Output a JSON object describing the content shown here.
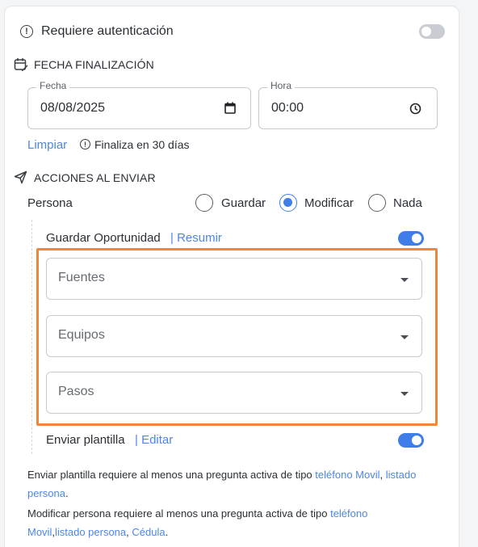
{
  "auth": {
    "label": "Requiere autenticación",
    "enabled": false
  },
  "fecha_section": {
    "title": "FECHA FINALIZACIÓN",
    "date_label": "Fecha",
    "date_value": "08/08/2025",
    "time_label": "Hora",
    "time_value": "00:00",
    "clear_label": "Limpiar",
    "ends_in": "Finaliza en 30 días"
  },
  "acciones": {
    "title": "ACCIONES AL ENVIAR",
    "persona_label": "Persona",
    "options": [
      "Guardar",
      "Modificar",
      "Nada"
    ],
    "selected": "Modificar",
    "guardar_oportunidad": {
      "label": "Guardar Oportunidad",
      "link": "| Resumir",
      "enabled": true
    },
    "selects": [
      {
        "placeholder": "Fuentes"
      },
      {
        "placeholder": "Equipos"
      },
      {
        "placeholder": "Pasos"
      }
    ],
    "enviar_plantilla": {
      "label": "Enviar plantilla",
      "link": "| Editar",
      "enabled": true
    }
  },
  "notes": {
    "n1_text": "Enviar plantilla requiere al menos una pregunta activa de tipo",
    "n1_kw1": "teléfono Movil",
    "n1_sep": ",",
    "n1_kw2": "listado",
    "n1_kw2b": "persona",
    "n1_end": ".",
    "n2_text": "Modificar persona requiere al menos una pregunta activa de tipo",
    "n2_kw1": "teléfono",
    "n2_kw1b": "Movil",
    "n2_sep1": ",",
    "n2_kw2": "listado persona",
    "n2_sep2": ",",
    "n2_kw3": "Cédula",
    "n2_end": "."
  },
  "colors": {
    "accent": "#3f7ee8",
    "link": "#4d86e6",
    "highlight": "#f2853a"
  }
}
